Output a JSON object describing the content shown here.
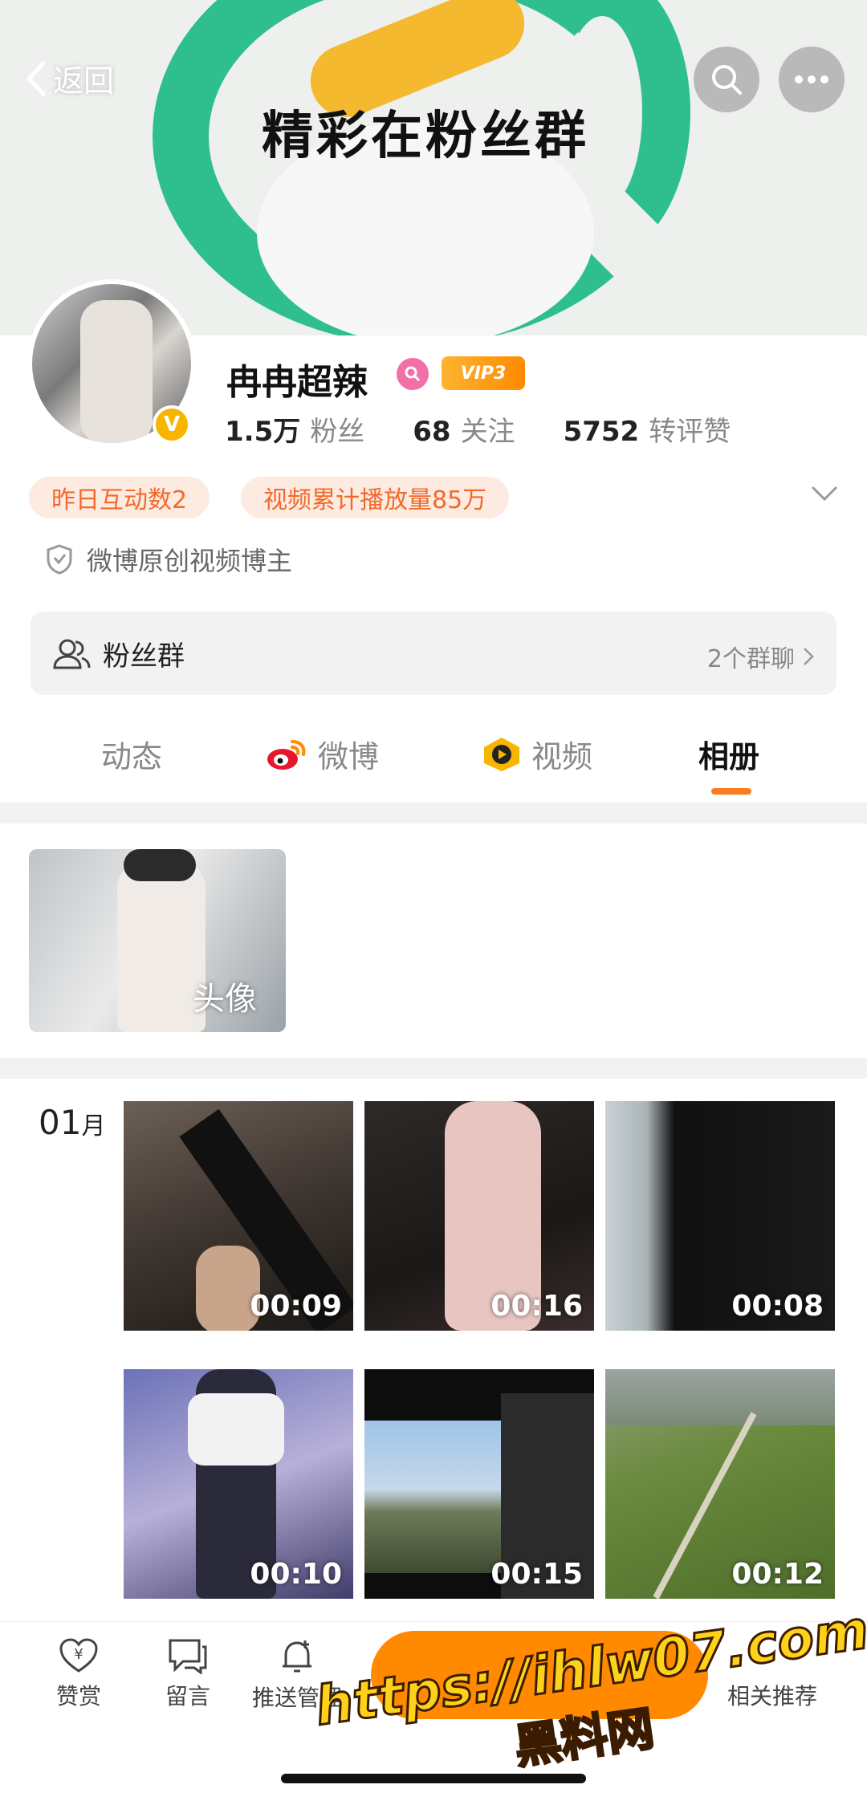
{
  "banner": {
    "text": "精彩在粉丝群"
  },
  "header": {
    "back_label": "返回",
    "search_icon": "search-icon",
    "more_icon": "more-icon"
  },
  "profile": {
    "name": "冉冉超辣",
    "vip_label": "VIP3",
    "verified_badge": "V",
    "stats": [
      {
        "value": "1.5万",
        "label": "粉丝"
      },
      {
        "value": "68",
        "label": "关注"
      },
      {
        "value": "5752",
        "label": "转评赞"
      }
    ],
    "tags": [
      "昨日互动数2",
      "视频累计播放量85万"
    ],
    "certification": "微博原创视频博主"
  },
  "fan_group": {
    "label": "粉丝群",
    "count": "2个群聊"
  },
  "tabs": [
    {
      "label": "动态"
    },
    {
      "label": "微博"
    },
    {
      "label": "视频"
    },
    {
      "label": "相册"
    }
  ],
  "album": {
    "label": "头像"
  },
  "videos": {
    "month": "01",
    "month_unit": "月",
    "durations": [
      "00:09",
      "00:16",
      "00:08",
      "00:10",
      "00:15",
      "00:12"
    ]
  },
  "bottom_bar": {
    "items": [
      {
        "label": "赞赏"
      },
      {
        "label": "留言"
      },
      {
        "label": "推送管理"
      },
      {
        "label": "相关推荐"
      }
    ]
  },
  "watermark": {
    "url": "https://ihlw07.com",
    "text": "黑料网"
  },
  "colors": {
    "accent": "#ff7a1a",
    "tag_bg": "#fdebe2",
    "green": "#2fbf8e",
    "yellow": "#f4b92e"
  }
}
